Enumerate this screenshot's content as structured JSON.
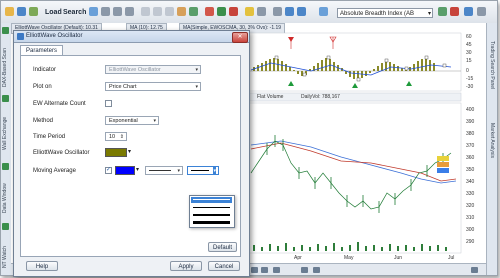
{
  "toolbar": {
    "load": "Load",
    "search": "Search",
    "indicator_select": "Absolute Breadth Index (AB"
  },
  "chart": {
    "tabs": [
      "ElliottWave Oscillator (Default): 10.31",
      "MA (10): 12.75",
      "MA(Simple, EWOSCMA, 30, 3% Ovs): -1.19"
    ],
    "volume_legend": [
      "Flat Volume",
      "DailyVol: 788,167"
    ],
    "months": [
      "Apr",
      "May",
      "Jun",
      "Jul"
    ],
    "right_axis_upper": [
      "60",
      "45",
      "30",
      "15",
      "0",
      "-15",
      "-30"
    ],
    "right_axis_lower": [
      "400",
      "390",
      "380",
      "370",
      "360",
      "350",
      "340",
      "330",
      "320",
      "310",
      "300",
      "290"
    ]
  },
  "left_strip": [
    "DAX-Based Scan",
    "Wall Exchange",
    "Data Window",
    "NT Watch"
  ],
  "right_strip": [
    "Trading Search Panel",
    "Market Analysis"
  ],
  "dialog": {
    "title": "ElliottWave Oscillator",
    "tab": "Parameters",
    "close": "✕",
    "rows": {
      "indicator": {
        "label": "Indicator",
        "value": "ElliottWave Oscillator"
      },
      "plot_on": {
        "label": "Plot on",
        "value": "Price Chart"
      },
      "alt_count": {
        "label": "EW Alternate Count"
      },
      "method": {
        "label": "Method",
        "value": "Exponential"
      },
      "time_period": {
        "label": "Time Period",
        "value": "10"
      },
      "osc": {
        "label": "ElliottWave Oscillator",
        "color": "#7a7a00"
      },
      "ma": {
        "label": "Moving Average",
        "color": "#0000ff"
      }
    },
    "buttons": {
      "default": "Default",
      "help": "Help",
      "apply": "Apply",
      "cancel": "Cancel"
    }
  },
  "colors": {
    "accent": "#3b82d6",
    "close": "#c9433b"
  }
}
